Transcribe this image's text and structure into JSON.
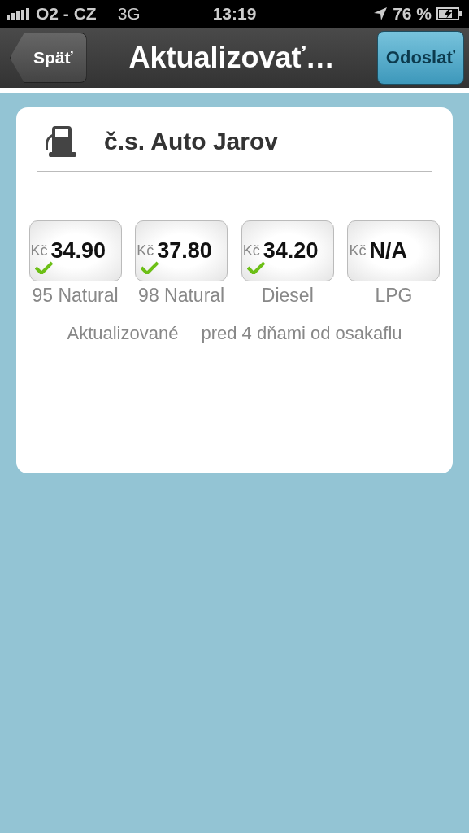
{
  "status_bar": {
    "carrier": "O2 - CZ",
    "network": "3G",
    "time": "13:19",
    "battery": "76 %"
  },
  "nav": {
    "back": "Späť",
    "title": "Aktualizovať…",
    "action": "Odoslať"
  },
  "station": {
    "name": "č.s. Auto Jarov"
  },
  "prices": [
    {
      "currency": "Kč",
      "value": "34.90",
      "fuel": "95 Natural",
      "confirmed": true
    },
    {
      "currency": "Kč",
      "value": "37.80",
      "fuel": "98 Natural",
      "confirmed": true
    },
    {
      "currency": "Kč",
      "value": "34.20",
      "fuel": "Diesel",
      "confirmed": true
    },
    {
      "currency": "Kč",
      "value": "N/A",
      "fuel": "LPG",
      "confirmed": false
    }
  ],
  "updated": {
    "label": "Aktualizované",
    "detail": "pred 4 dňami od osakaflu"
  }
}
